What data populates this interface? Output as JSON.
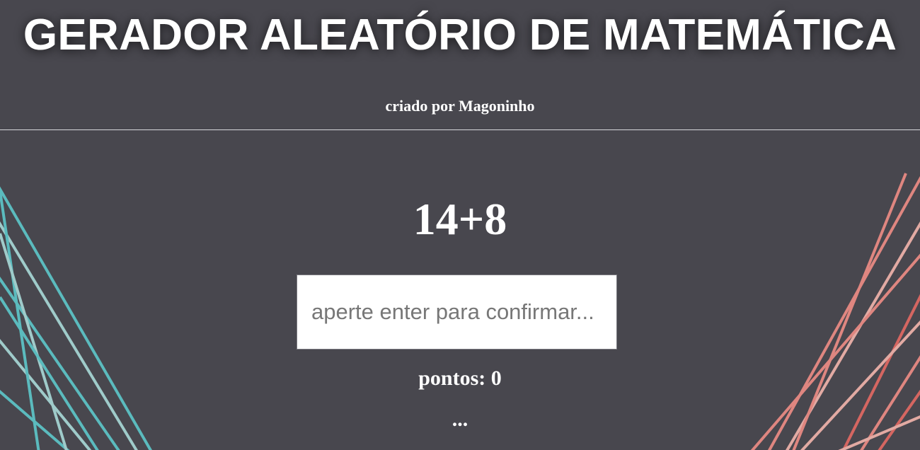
{
  "header": {
    "title": "GERADOR ALEATÓRIO DE MATEMÁTICA",
    "credit": "criado por Magoninho"
  },
  "game": {
    "problem": "14+8",
    "input_placeholder": "aperte enter para confirmar...",
    "input_value": "",
    "score_text": "pontos: 0",
    "feedback_text": "..."
  },
  "colors": {
    "background": "#48474e",
    "left_lines": "#5fc8cc",
    "right_lines": "#f08880",
    "text": "#ffffff"
  }
}
